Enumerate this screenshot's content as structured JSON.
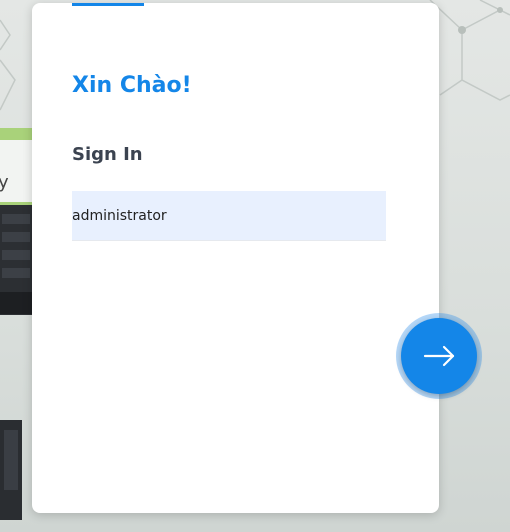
{
  "login": {
    "greeting": "Xin Chào!",
    "title": "Sign In",
    "username_value": "administrator"
  },
  "next_button": {
    "icon": "arrow-right-icon"
  },
  "background": {
    "brand_fragment": "y"
  },
  "colors": {
    "accent": "#1486e8",
    "input_bg": "#e8f0fe",
    "title_text": "#3b4350"
  }
}
